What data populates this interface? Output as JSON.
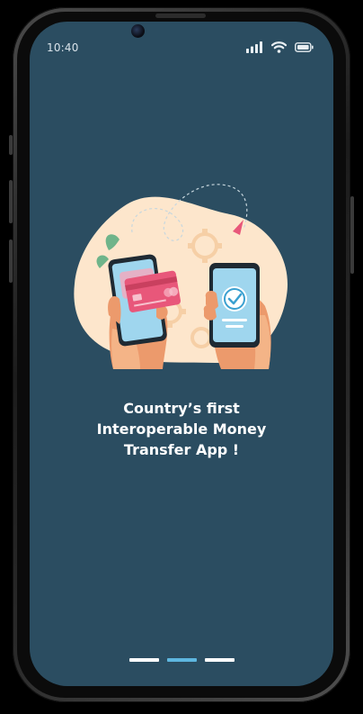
{
  "status_bar": {
    "time": "10:40",
    "icons": [
      "signal-icon",
      "wifi-icon",
      "battery-icon"
    ]
  },
  "onboarding": {
    "headline_lines": [
      "Country’s first",
      "Interoperable Money",
      "Transfer App !"
    ],
    "illustration": "phone-to-phone-money-transfer-illustration"
  },
  "pager": {
    "total": 3,
    "active_index": 1
  },
  "colors": {
    "screen_background": "#2b4d61",
    "blob": "#fde6cc",
    "accent": "#5eb7e0",
    "card": "#e8577a"
  }
}
